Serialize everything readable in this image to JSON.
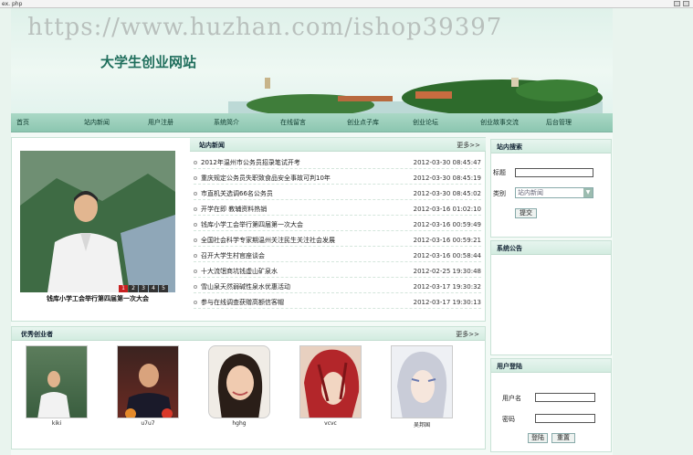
{
  "window": {
    "title": "ex. php"
  },
  "banner": {
    "watermark": "https://www.huzhan.com/ishop39397",
    "site_title": "大学生创业网站"
  },
  "nav": {
    "items": [
      "首页",
      "站内新闻",
      "用户注册",
      "系统简介",
      "在线留言",
      "创业点子库",
      "创业论坛",
      "创业故事交流",
      "后台管理"
    ]
  },
  "news": {
    "heading": "站内新闻",
    "more": "更多>>",
    "rows": [
      {
        "title": "2012年温州市公务员招录笔试开考",
        "date": "2012-03-30 08:45:47"
      },
      {
        "title": "重庆规定公务员失职致食品安全事故可判10年",
        "date": "2012-03-30 08:45:19"
      },
      {
        "title": "市直机关选调66名公务员",
        "date": "2012-03-30 08:45:02"
      },
      {
        "title": "开学在即 教辅资料热销",
        "date": "2012-03-16 01:02:10"
      },
      {
        "title": "钱库小学工会举行第四届第一次大会",
        "date": "2012-03-16 00:59:49"
      },
      {
        "title": "全国社会科学专家期温州关注民生关注社会发展",
        "date": "2012-03-16 00:59:21"
      },
      {
        "title": "召开大学生村官座谈会",
        "date": "2012-03-16 00:58:44"
      },
      {
        "title": "十大流氓商坑钱虚山矿泉水",
        "date": "2012-02-25 19:30:48"
      },
      {
        "title": "雪山泉天然弱碱性泉水优惠活动",
        "date": "2012-03-17 19:30:32"
      },
      {
        "title": "参与在线调查获赠高额信客帽",
        "date": "2012-03-17 19:30:13"
      }
    ]
  },
  "slideshow": {
    "caption": "钱库小学工会举行第四届第一次大会",
    "pages": [
      "1",
      "2",
      "3",
      "4",
      "5"
    ],
    "active": 1
  },
  "entrepreneurs": {
    "heading": "优秀创业者",
    "more": "更多>>",
    "people": [
      {
        "name": "kiki",
        "icon": "man-portrait"
      },
      {
        "name": "u7u7",
        "icon": "man-portrait"
      },
      {
        "name": "hghg",
        "icon": "woman-portrait"
      },
      {
        "name": "vcvc",
        "icon": "anime-red-hair-portrait"
      },
      {
        "name": "吴邦国",
        "icon": "anime-white-hair-portrait"
      }
    ]
  },
  "search": {
    "heading": "站内搜索",
    "title_label": "标题",
    "title_value": "",
    "category_label": "类别",
    "category_value": "站内新闻",
    "submit": "提交"
  },
  "announcement": {
    "heading": "系统公告"
  },
  "login": {
    "heading": "用户登陆",
    "username_label": "用户名",
    "username_value": "",
    "password_label": "密码",
    "password_value": "",
    "login_button": "登陆",
    "reset_button": "重置"
  },
  "colors": {
    "nav": "#9ccfbb",
    "accent": "#1f6e5c",
    "active_page": "#c82020"
  }
}
